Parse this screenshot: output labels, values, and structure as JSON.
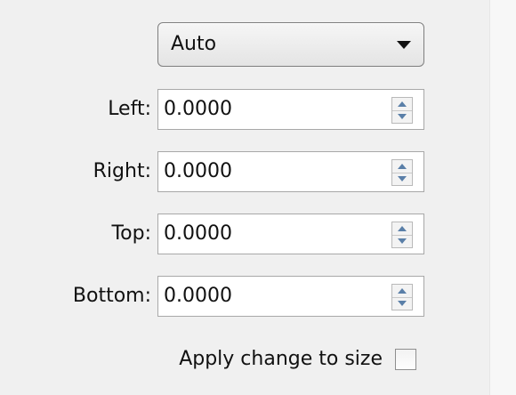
{
  "dropdown": {
    "value": "Auto"
  },
  "fields": [
    {
      "label": "Left:",
      "value": "0.0000"
    },
    {
      "label": "Right:",
      "value": "0.0000"
    },
    {
      "label": "Top:",
      "value": "0.0000"
    },
    {
      "label": "Bottom:",
      "value": "0.0000"
    }
  ],
  "apply": {
    "label": "Apply change to size",
    "checked": false
  },
  "colors": {
    "panel_bg": "#f0f0f0",
    "spin_arrow": "#5a7fa8"
  }
}
